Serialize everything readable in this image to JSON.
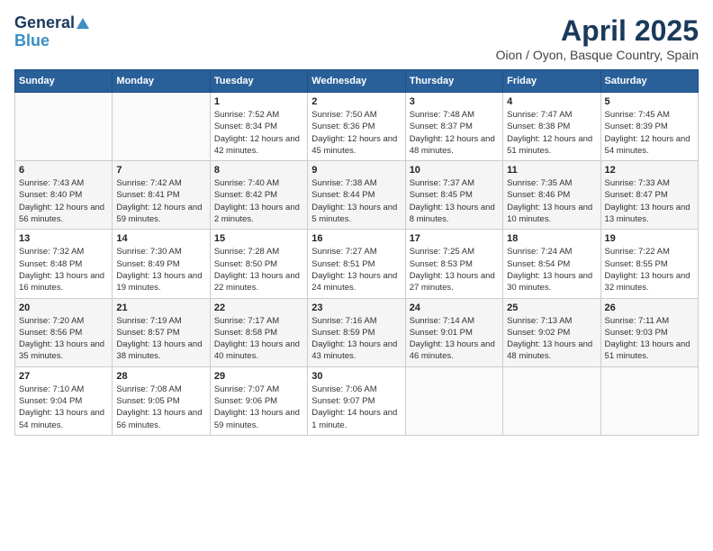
{
  "header": {
    "logo_line1": "General",
    "logo_line2": "Blue",
    "month_year": "April 2025",
    "location": "Oion / Oyon, Basque Country, Spain"
  },
  "weekdays": [
    "Sunday",
    "Monday",
    "Tuesday",
    "Wednesday",
    "Thursday",
    "Friday",
    "Saturday"
  ],
  "weeks": [
    [
      {
        "day": "",
        "info": ""
      },
      {
        "day": "",
        "info": ""
      },
      {
        "day": "1",
        "info": "Sunrise: 7:52 AM\nSunset: 8:34 PM\nDaylight: 12 hours and 42 minutes."
      },
      {
        "day": "2",
        "info": "Sunrise: 7:50 AM\nSunset: 8:36 PM\nDaylight: 12 hours and 45 minutes."
      },
      {
        "day": "3",
        "info": "Sunrise: 7:48 AM\nSunset: 8:37 PM\nDaylight: 12 hours and 48 minutes."
      },
      {
        "day": "4",
        "info": "Sunrise: 7:47 AM\nSunset: 8:38 PM\nDaylight: 12 hours and 51 minutes."
      },
      {
        "day": "5",
        "info": "Sunrise: 7:45 AM\nSunset: 8:39 PM\nDaylight: 12 hours and 54 minutes."
      }
    ],
    [
      {
        "day": "6",
        "info": "Sunrise: 7:43 AM\nSunset: 8:40 PM\nDaylight: 12 hours and 56 minutes."
      },
      {
        "day": "7",
        "info": "Sunrise: 7:42 AM\nSunset: 8:41 PM\nDaylight: 12 hours and 59 minutes."
      },
      {
        "day": "8",
        "info": "Sunrise: 7:40 AM\nSunset: 8:42 PM\nDaylight: 13 hours and 2 minutes."
      },
      {
        "day": "9",
        "info": "Sunrise: 7:38 AM\nSunset: 8:44 PM\nDaylight: 13 hours and 5 minutes."
      },
      {
        "day": "10",
        "info": "Sunrise: 7:37 AM\nSunset: 8:45 PM\nDaylight: 13 hours and 8 minutes."
      },
      {
        "day": "11",
        "info": "Sunrise: 7:35 AM\nSunset: 8:46 PM\nDaylight: 13 hours and 10 minutes."
      },
      {
        "day": "12",
        "info": "Sunrise: 7:33 AM\nSunset: 8:47 PM\nDaylight: 13 hours and 13 minutes."
      }
    ],
    [
      {
        "day": "13",
        "info": "Sunrise: 7:32 AM\nSunset: 8:48 PM\nDaylight: 13 hours and 16 minutes."
      },
      {
        "day": "14",
        "info": "Sunrise: 7:30 AM\nSunset: 8:49 PM\nDaylight: 13 hours and 19 minutes."
      },
      {
        "day": "15",
        "info": "Sunrise: 7:28 AM\nSunset: 8:50 PM\nDaylight: 13 hours and 22 minutes."
      },
      {
        "day": "16",
        "info": "Sunrise: 7:27 AM\nSunset: 8:51 PM\nDaylight: 13 hours and 24 minutes."
      },
      {
        "day": "17",
        "info": "Sunrise: 7:25 AM\nSunset: 8:53 PM\nDaylight: 13 hours and 27 minutes."
      },
      {
        "day": "18",
        "info": "Sunrise: 7:24 AM\nSunset: 8:54 PM\nDaylight: 13 hours and 30 minutes."
      },
      {
        "day": "19",
        "info": "Sunrise: 7:22 AM\nSunset: 8:55 PM\nDaylight: 13 hours and 32 minutes."
      }
    ],
    [
      {
        "day": "20",
        "info": "Sunrise: 7:20 AM\nSunset: 8:56 PM\nDaylight: 13 hours and 35 minutes."
      },
      {
        "day": "21",
        "info": "Sunrise: 7:19 AM\nSunset: 8:57 PM\nDaylight: 13 hours and 38 minutes."
      },
      {
        "day": "22",
        "info": "Sunrise: 7:17 AM\nSunset: 8:58 PM\nDaylight: 13 hours and 40 minutes."
      },
      {
        "day": "23",
        "info": "Sunrise: 7:16 AM\nSunset: 8:59 PM\nDaylight: 13 hours and 43 minutes."
      },
      {
        "day": "24",
        "info": "Sunrise: 7:14 AM\nSunset: 9:01 PM\nDaylight: 13 hours and 46 minutes."
      },
      {
        "day": "25",
        "info": "Sunrise: 7:13 AM\nSunset: 9:02 PM\nDaylight: 13 hours and 48 minutes."
      },
      {
        "day": "26",
        "info": "Sunrise: 7:11 AM\nSunset: 9:03 PM\nDaylight: 13 hours and 51 minutes."
      }
    ],
    [
      {
        "day": "27",
        "info": "Sunrise: 7:10 AM\nSunset: 9:04 PM\nDaylight: 13 hours and 54 minutes."
      },
      {
        "day": "28",
        "info": "Sunrise: 7:08 AM\nSunset: 9:05 PM\nDaylight: 13 hours and 56 minutes."
      },
      {
        "day": "29",
        "info": "Sunrise: 7:07 AM\nSunset: 9:06 PM\nDaylight: 13 hours and 59 minutes."
      },
      {
        "day": "30",
        "info": "Sunrise: 7:06 AM\nSunset: 9:07 PM\nDaylight: 14 hours and 1 minute."
      },
      {
        "day": "",
        "info": ""
      },
      {
        "day": "",
        "info": ""
      },
      {
        "day": "",
        "info": ""
      }
    ]
  ]
}
